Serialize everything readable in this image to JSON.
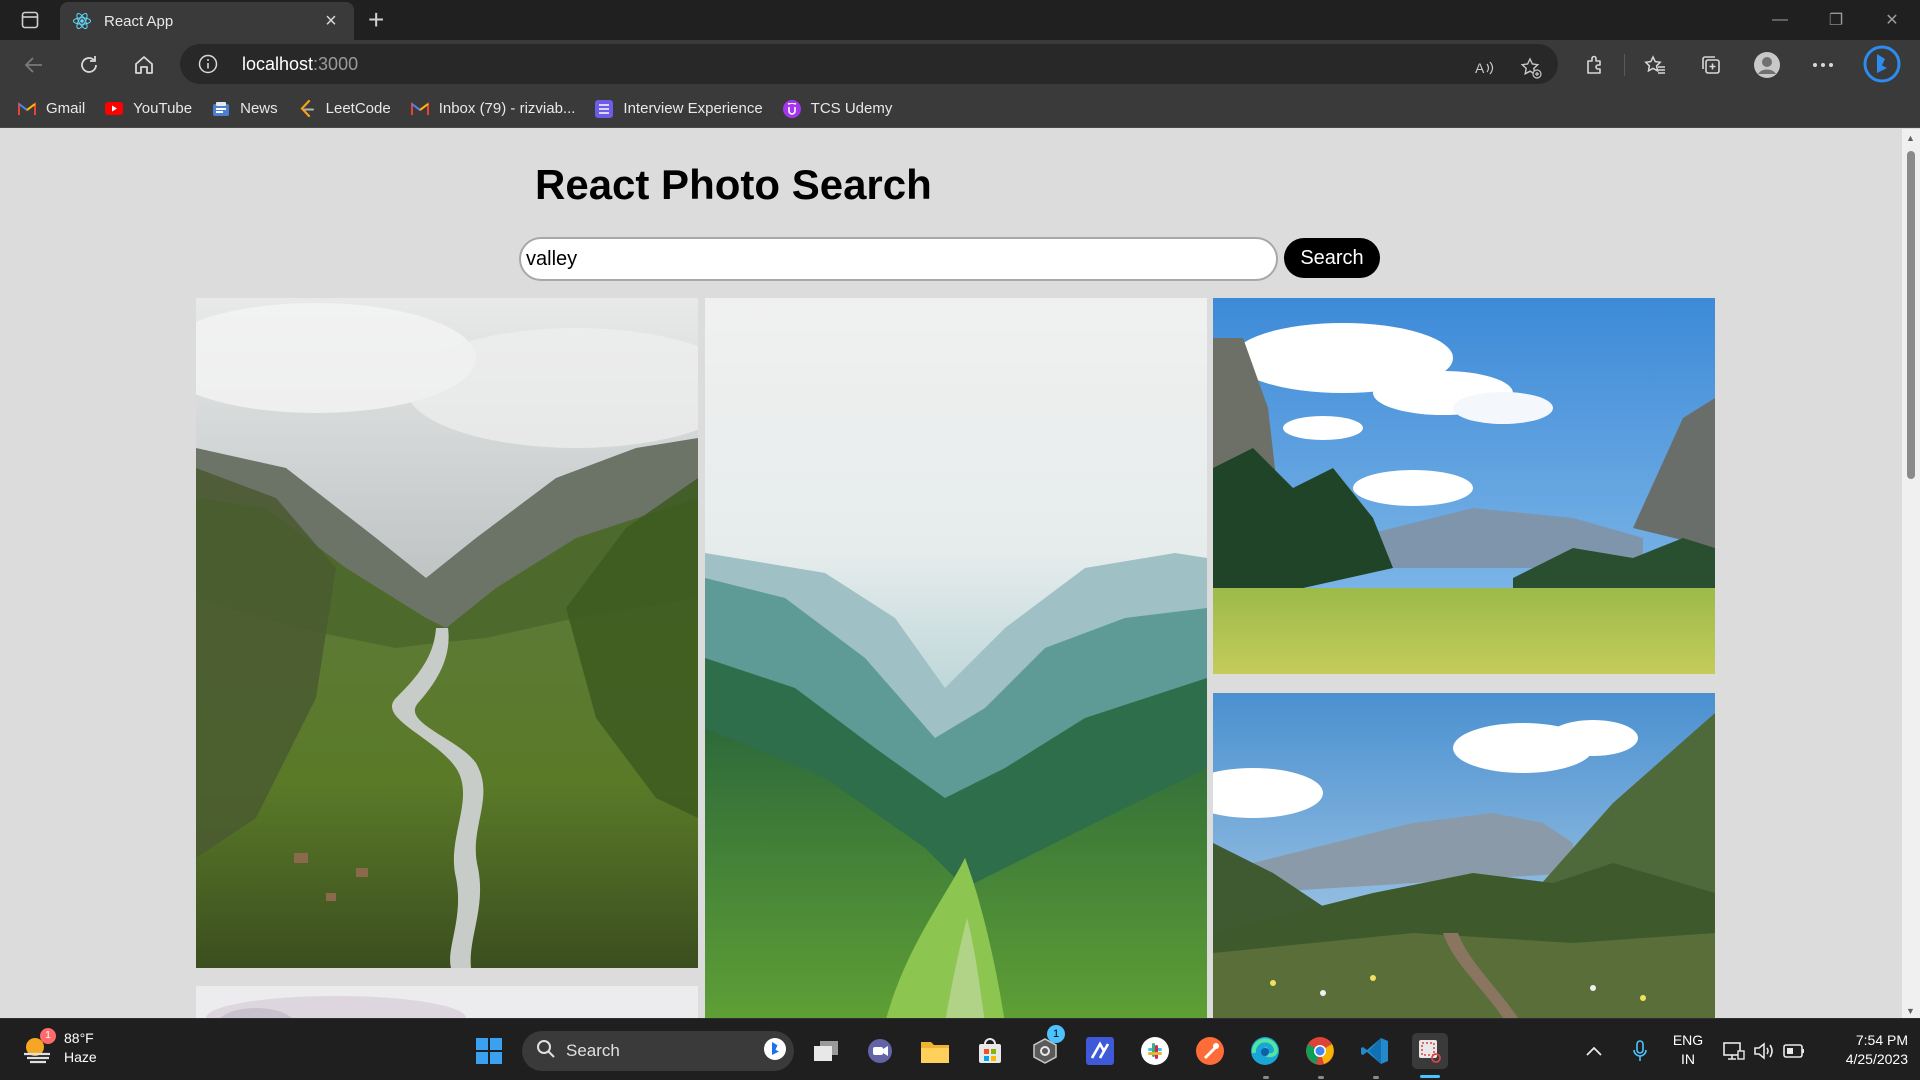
{
  "browser": {
    "tab_title": "React App",
    "url_host": "localhost",
    "url_port": ":3000",
    "bookmarks": [
      {
        "label": "Gmail",
        "icon": "gmail-icon",
        "color": "#ea4335"
      },
      {
        "label": "YouTube",
        "icon": "youtube-icon",
        "color": "#ff0000"
      },
      {
        "label": "News",
        "icon": "news-icon",
        "color": "#4a7fd4"
      },
      {
        "label": "LeetCode",
        "icon": "leetcode-icon",
        "color": "#f89f1b"
      },
      {
        "label": "Inbox (79) - rizviab...",
        "icon": "gmail-icon",
        "color": "#ea4335"
      },
      {
        "label": "Interview Experience",
        "icon": "list-icon",
        "color": "#6c5ce7"
      },
      {
        "label": "TCS Udemy",
        "icon": "udemy-icon",
        "color": "#a435f0"
      }
    ]
  },
  "app": {
    "title": "React Photo Search",
    "search_value": "valley",
    "search_button": "Search"
  },
  "taskbar": {
    "weather_temp": "88°F",
    "weather_desc": "Haze",
    "weather_badge": "1",
    "search_label": "Search",
    "lang_1": "ENG",
    "lang_2": "IN",
    "time": "7:54 PM",
    "date": "4/25/2023",
    "badge_count": "1"
  }
}
